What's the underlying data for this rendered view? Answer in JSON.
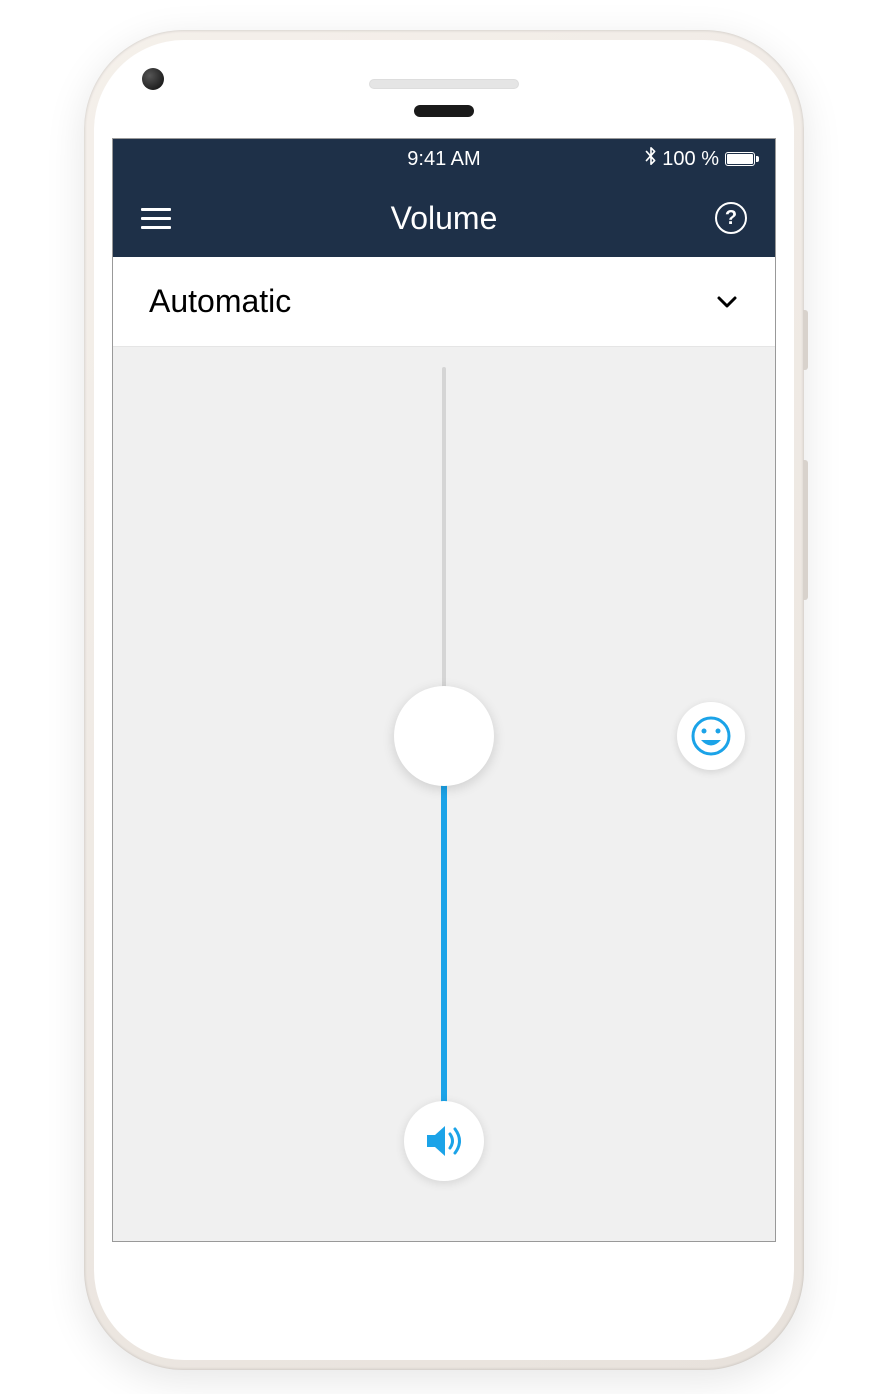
{
  "status_bar": {
    "time": "9:41 AM",
    "battery_text": "100 %",
    "bluetooth_icon": "bluetooth",
    "battery_level": 100
  },
  "nav": {
    "title": "Volume",
    "help_label": "?"
  },
  "mode_selector": {
    "selected": "Automatic"
  },
  "slider": {
    "value": 50,
    "min": 0,
    "max": 100
  },
  "colors": {
    "accent": "#1ba3e8",
    "nav_bg": "#1e3048"
  }
}
